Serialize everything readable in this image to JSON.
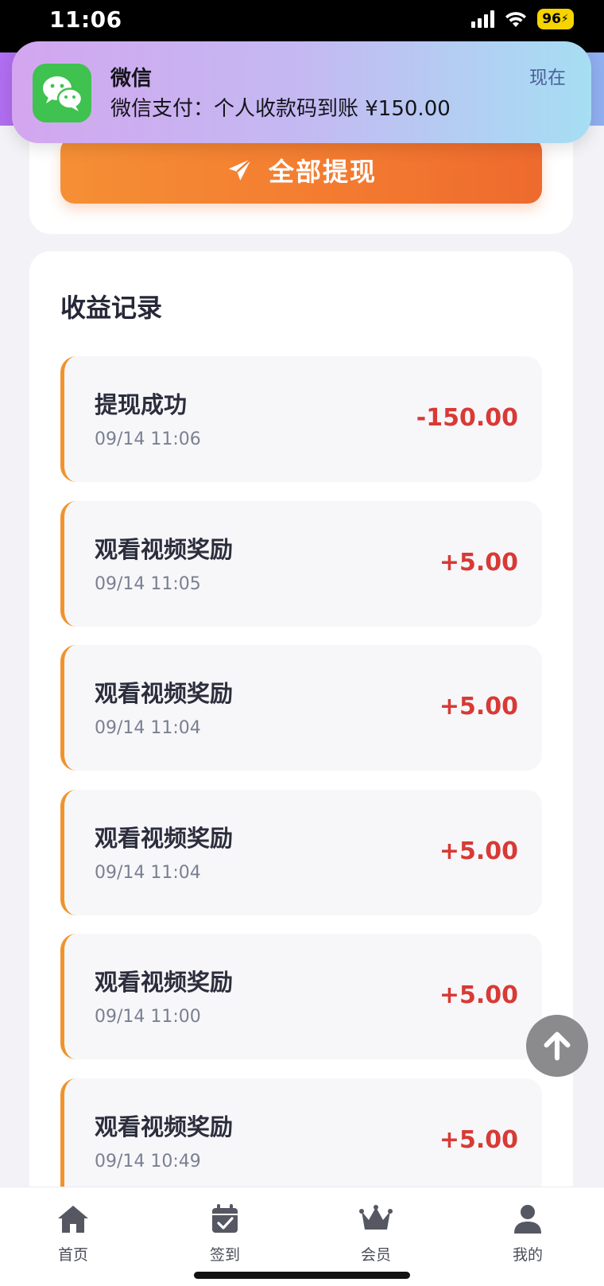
{
  "status_bar": {
    "time": "11:06",
    "battery": "96"
  },
  "notification": {
    "app_name": "微信",
    "message": "微信支付：个人收款码到账 ¥150.00",
    "time": "现在"
  },
  "withdraw": {
    "button_label": "全部提现"
  },
  "records": {
    "title": "收益记录",
    "items": [
      {
        "title": "提现成功",
        "time": "09/14 11:06",
        "amount": "-150.00"
      },
      {
        "title": "观看视频奖励",
        "time": "09/14 11:05",
        "amount": "+5.00"
      },
      {
        "title": "观看视频奖励",
        "time": "09/14 11:04",
        "amount": "+5.00"
      },
      {
        "title": "观看视频奖励",
        "time": "09/14 11:04",
        "amount": "+5.00"
      },
      {
        "title": "观看视频奖励",
        "time": "09/14 11:00",
        "amount": "+5.00"
      },
      {
        "title": "观看视频奖励",
        "time": "09/14 10:49",
        "amount": "+5.00"
      }
    ]
  },
  "tab_bar": {
    "items": [
      {
        "label": "首页",
        "icon": "home-icon"
      },
      {
        "label": "签到",
        "icon": "calendar-check-icon"
      },
      {
        "label": "会员",
        "icon": "crown-icon"
      },
      {
        "label": "我的",
        "icon": "user-icon"
      }
    ]
  },
  "colors": {
    "accent_orange": "#f37a30",
    "amount_red": "#d83a35",
    "record_border": "#f0932c"
  }
}
